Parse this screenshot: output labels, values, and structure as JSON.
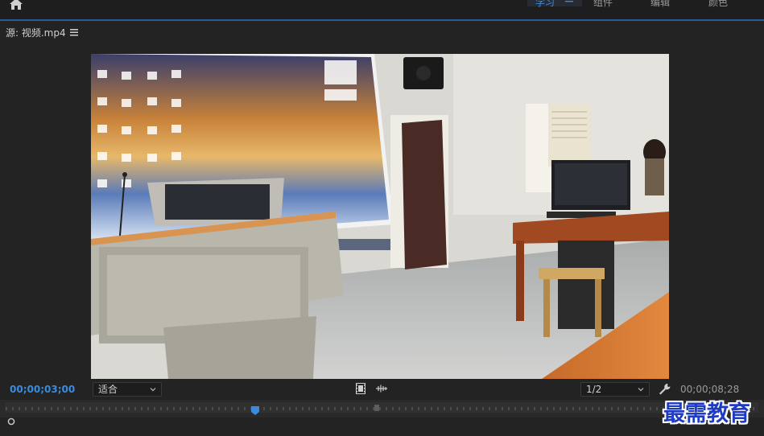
{
  "workspace_tabs": {
    "learn": "学习",
    "assembly": "组件",
    "editing": "编辑",
    "color": "颜色"
  },
  "source_panel": {
    "title": "源: 视频.mp4"
  },
  "controls": {
    "current_timecode": "00;00;03;00",
    "fit_value": "适合",
    "resolution_value": "1/2",
    "duration_timecode": "00;00;08;28"
  },
  "timeline": {
    "playhead_time": "00;00;03;00"
  },
  "watermark": {
    "text": "最需教育"
  },
  "colors": {
    "accent_blue": "#3a8be0",
    "panel_bg": "#232323",
    "watermark_blue": "#1f3cc0"
  },
  "icons": [
    "home-icon",
    "menu-icon",
    "hamburger-icon",
    "chevron-down-icon",
    "film-icon",
    "waveform-icon",
    "wrench-icon",
    "playhead-icon",
    "in-point-icon"
  ]
}
